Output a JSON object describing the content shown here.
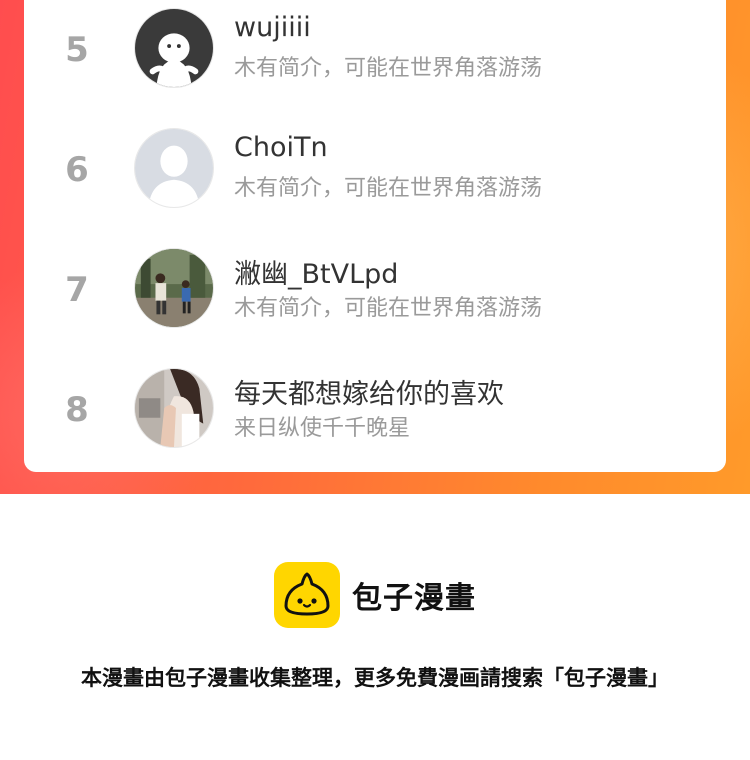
{
  "ranking": {
    "items": [
      {
        "rank": "5",
        "name": "wujiiii",
        "bio": "木有简介，可能在世界角落游荡",
        "avatar": "ghost-avatar"
      },
      {
        "rank": "6",
        "name": "ChoiTn",
        "bio": "木有简介，可能在世界角落游荡",
        "avatar": "default-user-avatar"
      },
      {
        "rank": "7",
        "name": "潎幽_BtVLpd",
        "bio": "木有简介，可能在世界角落游荡",
        "avatar": "photo-avatar-outdoor"
      },
      {
        "rank": "8",
        "name": "每天都想嫁给你的喜欢",
        "bio": "来日纵使千千晚星",
        "avatar": "photo-avatar-girl"
      }
    ]
  },
  "brand": {
    "name": "包子漫畫",
    "icon": "bun-logo-icon",
    "accent": "#ffd600"
  },
  "footer": {
    "note": "本漫畫由包子漫畫收集整理，更多免費漫画請搜索「包子漫畫」"
  },
  "colors": {
    "banner_start": "#ff4d4f",
    "banner_end": "#ff9a2a",
    "rank_text": "#a6a6a6",
    "bio_text": "#9a9a9a"
  }
}
